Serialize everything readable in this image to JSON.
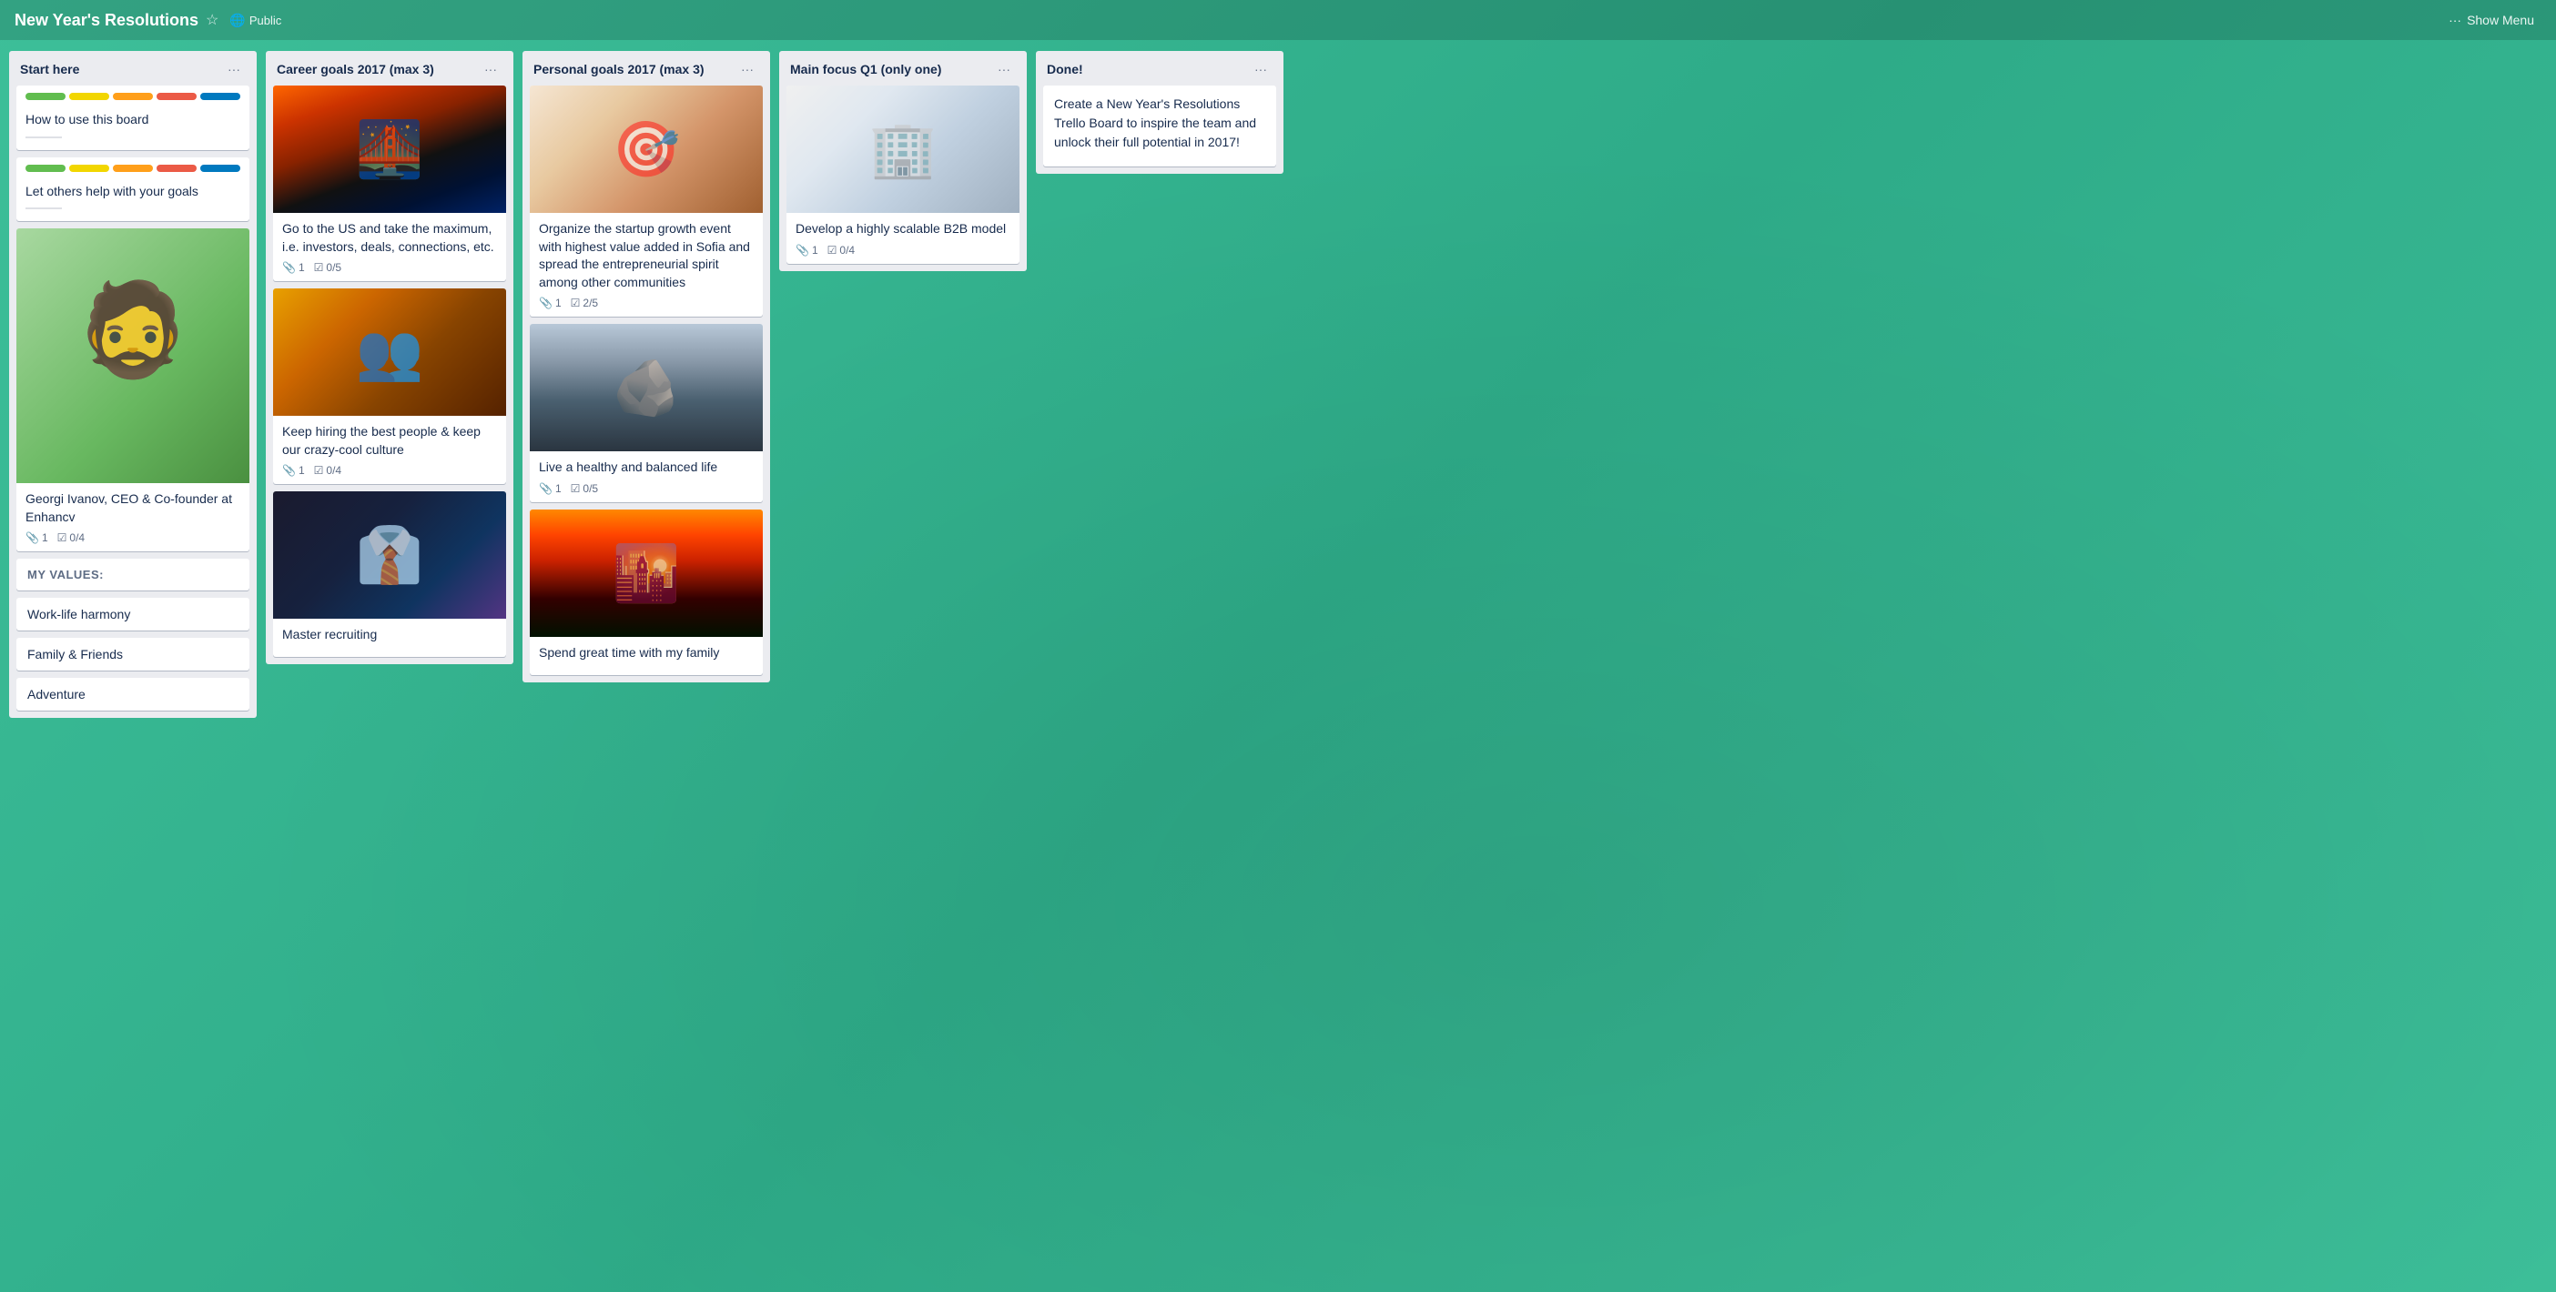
{
  "header": {
    "title": "New Year's Resolutions",
    "visibility": "Public",
    "show_menu_label": "Show Menu",
    "ellipsis": "···"
  },
  "lists": [
    {
      "id": "start-here",
      "title": "Start here",
      "cards": [
        {
          "id": "how-to-use",
          "title": "How to use this board",
          "has_desc": true,
          "has_colors": true,
          "colors": [
            "#61bd4f",
            "#f2d600",
            "#ff9f1a",
            "#eb5a46",
            "#0079bf"
          ]
        },
        {
          "id": "let-others-help",
          "title": "Let others help with your goals",
          "has_desc": true,
          "has_colors": true,
          "colors": [
            "#61bd4f",
            "#f2d600",
            "#ff9f1a",
            "#eb5a46",
            "#0079bf"
          ]
        },
        {
          "id": "georgi",
          "title": "Georgi Ivanov, CEO & Co-founder at Enhancv",
          "image_type": "person",
          "attachments": 1,
          "checklist": "0/4"
        },
        {
          "id": "my-values",
          "type": "label",
          "text": "MY VALUES:"
        },
        {
          "id": "work-life",
          "type": "value",
          "text": "Work-life harmony"
        },
        {
          "id": "family-friends",
          "type": "value",
          "text": "Family & Friends"
        },
        {
          "id": "adventure",
          "type": "value",
          "text": "Adventure"
        }
      ]
    },
    {
      "id": "career-goals",
      "title": "Career goals 2017 (max 3)",
      "cards": [
        {
          "id": "go-to-us",
          "title": "Go to the US and take the maximum, i.e. investors, deals, connections, etc.",
          "image_type": "bridge",
          "attachments": 1,
          "checklist": "0/5"
        },
        {
          "id": "keep-hiring",
          "title": "Keep hiring the best people & keep our crazy-cool culture",
          "image_type": "group",
          "attachments": 1,
          "checklist": "0/4"
        },
        {
          "id": "master-recruiting",
          "title": "Master recruiting",
          "image_type": "team"
        }
      ]
    },
    {
      "id": "personal-goals",
      "title": "Personal goals 2017 (max 3)",
      "cards": [
        {
          "id": "startup-growth",
          "title": "Organize the startup growth event with highest value added in Sofia and spread the entrepreneurial spirit among other communities",
          "image_type": "presentation",
          "attachments": 1,
          "checklist": "2/5"
        },
        {
          "id": "healthy-life",
          "title": "Live a healthy and balanced life",
          "image_type": "stones",
          "attachments": 1,
          "checklist": "0/5"
        },
        {
          "id": "family-time",
          "title": "Spend great time with my family",
          "image_type": "sunset"
        }
      ]
    },
    {
      "id": "main-focus",
      "title": "Main focus Q1 (only one)",
      "cards": [
        {
          "id": "b2b-model",
          "title": "Develop a highly scalable B2B model",
          "image_type": "office",
          "attachments": 1,
          "checklist": "0/4"
        }
      ]
    },
    {
      "id": "done",
      "title": "Done!",
      "cards": [
        {
          "id": "create-board",
          "title": "Create a New Year's Resolutions Trello Board to inspire the team and unlock their full potential in 2017!"
        }
      ]
    }
  ]
}
